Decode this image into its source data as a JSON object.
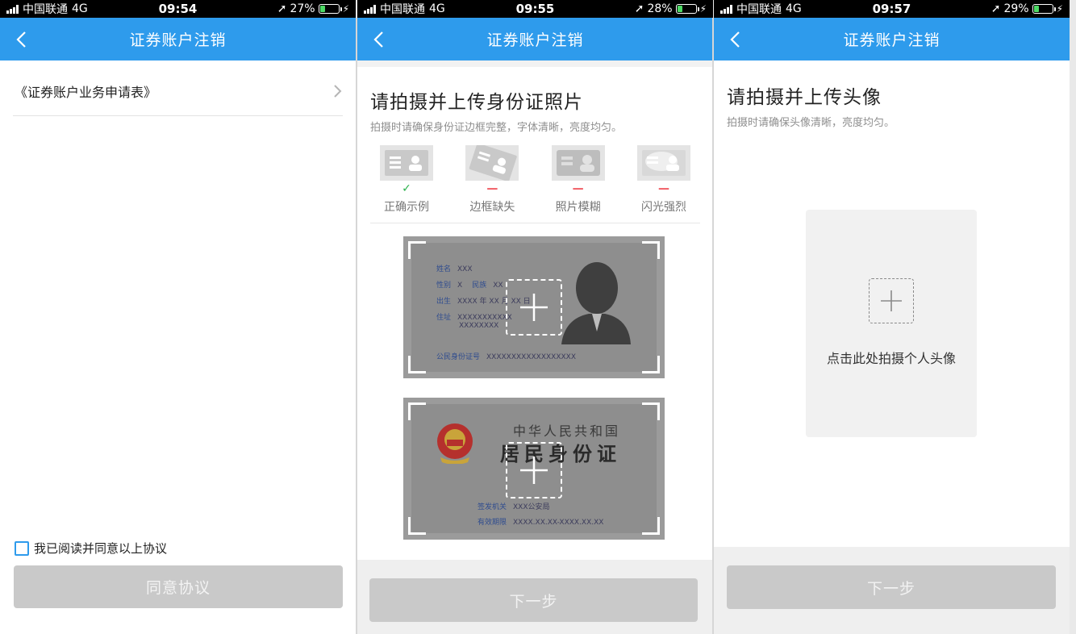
{
  "screens": [
    {
      "status": {
        "carrier": "中国联通",
        "network": "4G",
        "time": "09:54",
        "battery": "27%",
        "battery_level": 0.27
      },
      "nav": {
        "title": "证券账户注销"
      },
      "agreement_link": "《证券账户业务申请表》",
      "agree_text": "我已阅读并同意以上协议",
      "agree_checked": false,
      "button": "同意协议"
    },
    {
      "status": {
        "carrier": "中国联通",
        "network": "4G",
        "time": "09:55",
        "battery": "28%",
        "battery_level": 0.28
      },
      "nav": {
        "title": "证券账户注销"
      },
      "heading": "请拍摄并上传身份证照片",
      "sub": "拍摄时请确保身份证边框完整，字体清晰，亮度均匀。",
      "examples": [
        {
          "label": "正确示例",
          "mark": "✓"
        },
        {
          "label": "边框缺失",
          "mark": "—"
        },
        {
          "label": "照片模糊",
          "mark": "—"
        },
        {
          "label": "闪光强烈",
          "mark": "—"
        }
      ],
      "front": {
        "name_label": "姓名",
        "name": "XXX",
        "sex_label": "性别",
        "sex": "X",
        "ethnic_label": "民族",
        "ethnic": "XX",
        "birth_label": "出生",
        "birth": "XXXX 年 XX 月 XX 日",
        "addr_label": "住址",
        "addr1": "XXXXXXXXXXX",
        "addr2": "XXXXXXXX",
        "idno_label": "公民身份证号",
        "idno": "XXXXXXXXXXXXXXXXXX"
      },
      "back": {
        "country": "中华人民共和国",
        "card_title": "居民身份证",
        "authority_label": "签发机关",
        "authority": "XXX公安局",
        "validity_label": "有效期限",
        "validity": "XXXX.XX.XX-XXXX.XX.XX"
      },
      "button": "下一步"
    },
    {
      "status": {
        "carrier": "中国联通",
        "network": "4G",
        "time": "09:57",
        "battery": "29%",
        "battery_level": 0.29
      },
      "nav": {
        "title": "证券账户注销"
      },
      "heading": "请拍摄并上传头像",
      "sub": "拍摄时请确保头像清晰，亮度均匀。",
      "tile_caption": "点击此处拍摄个人头像",
      "button": "下一步"
    }
  ],
  "colors": {
    "nav": "#2e9bec",
    "ok": "#2bb24c",
    "bad": "#f0525b",
    "button_disabled": "#c9c9c9"
  }
}
